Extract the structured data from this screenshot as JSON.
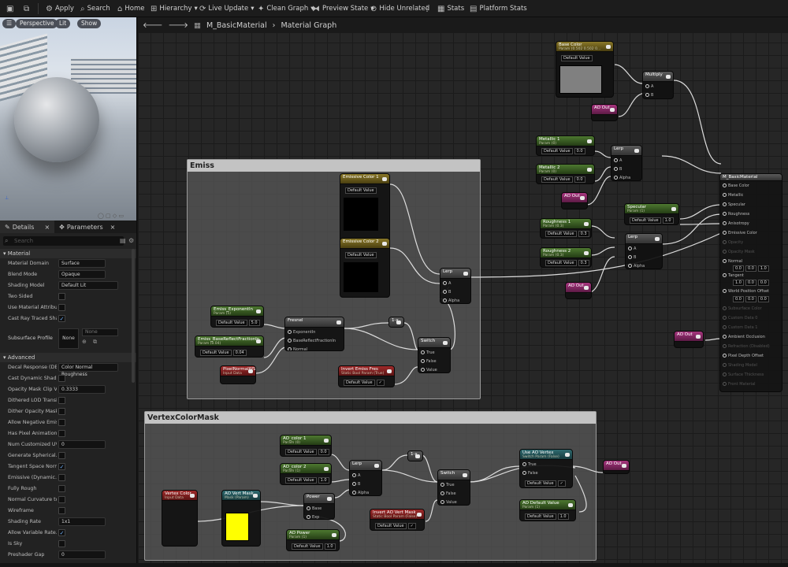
{
  "toolbar": {
    "apply": "Apply",
    "search": "Search",
    "home": "Home",
    "hierarchy": "Hierarchy",
    "live_update": "Live Update",
    "clean_graph": "Clean Graph",
    "preview_state": "Preview State",
    "hide_unrelated": "Hide Unrelated",
    "stats": "Stats",
    "platform_stats": "Platform Stats"
  },
  "viewport": {
    "perspective": "Perspective",
    "lit": "Lit",
    "show": "Show"
  },
  "details": {
    "tab_details": "Details",
    "tab_parameters": "Parameters",
    "search_placeholder": "Search",
    "cat_material": "Material",
    "cat_advanced": "Advanced",
    "rows_material": [
      {
        "label": "Material Domain",
        "value": "Surface"
      },
      {
        "label": "Blend Mode",
        "value": "Opaque"
      },
      {
        "label": "Shading Model",
        "value": "Default Lit"
      },
      {
        "label": "Two Sided",
        "value": ""
      },
      {
        "label": "Use Material Attribut...",
        "value": ""
      },
      {
        "label": "Cast Ray Traced Sha...",
        "value": "✓"
      }
    ],
    "subsurface_label": "Subsurface Profile",
    "subsurface_value": "None",
    "subsurface_combo": "None",
    "rows_advanced": [
      {
        "label": "Decal Response (DB...",
        "value": "Color Normal Roughness"
      },
      {
        "label": "Cast Dynamic Shado...",
        "value": ""
      },
      {
        "label": "Opacity Mask Clip V...",
        "value": "0.3333"
      },
      {
        "label": "Dithered LOD Transi...",
        "value": ""
      },
      {
        "label": "Dither Opacity Mask",
        "value": ""
      },
      {
        "label": "Allow Negative Emis...",
        "value": ""
      },
      {
        "label": "Has Pixel Animation",
        "value": ""
      },
      {
        "label": "Num Customized UVs",
        "value": "0"
      },
      {
        "label": "Generate Spherical...",
        "value": ""
      },
      {
        "label": "Tangent Space Normal",
        "value": "✓"
      },
      {
        "label": "Emissive (Dynamic...",
        "value": ""
      },
      {
        "label": "Fully Rough",
        "value": ""
      },
      {
        "label": "Normal Curvature to...",
        "value": ""
      },
      {
        "label": "Wireframe",
        "value": ""
      },
      {
        "label": "Shading Rate",
        "value": "1x1"
      },
      {
        "label": "Allow Variable Rate...",
        "value": "✓"
      },
      {
        "label": "Is Sky",
        "value": ""
      },
      {
        "label": "Preshader Gap",
        "value": "0"
      }
    ]
  },
  "breadcrumb": {
    "material": "M_BasicMaterial",
    "graph": "Material Graph"
  },
  "comments": {
    "emiss": "Emiss",
    "vcm": "VertexColorMask"
  },
  "nodes": {
    "base_color": {
      "title": "Base Color",
      "sub": "Param (0.502 0.502 0...",
      "dv_label": "Default Value"
    },
    "multiply": {
      "title": "Multiply",
      "a": "A",
      "b": "B"
    },
    "ao_out_1": {
      "title": "AO Out"
    },
    "metallic1": {
      "title": "Metallic 1",
      "sub": "Param (0)",
      "dv_label": "Default Value",
      "dv": "0.0"
    },
    "metallic2": {
      "title": "Metallic 2",
      "sub": "Param (0)",
      "dv_label": "Default Value",
      "dv": "0.0"
    },
    "lerp_m": {
      "title": "Lerp",
      "a": "A",
      "b": "B",
      "alpha": "Alpha"
    },
    "ao_out_2": {
      "title": "AO Out"
    },
    "specular": {
      "title": "Specular",
      "sub": "Param (1)",
      "dv_label": "Default Value",
      "dv": "1.0"
    },
    "rough1": {
      "title": "Roughness 1",
      "sub": "Param (0.3)",
      "dv_label": "Default Value",
      "dv": "0.3"
    },
    "rough2": {
      "title": "Roughness 2",
      "sub": "Param (0.3)",
      "dv_label": "Default Value",
      "dv": "0.3"
    },
    "lerp_r": {
      "title": "Lerp",
      "a": "A",
      "b": "B",
      "alpha": "Alpha"
    },
    "ao_out_3": {
      "title": "AO Out"
    },
    "ao_out_4": {
      "title": "AO Out"
    },
    "result": {
      "title": "M_BasicMaterial",
      "pins": [
        "Base Color",
        "Metallic",
        "Specular",
        "Roughness",
        "Anisotropy",
        "Emissive Color",
        "Opacity",
        "Opacity Mask",
        "Normal",
        "Tangent",
        "World Position Offset",
        "Subsurface Color",
        "Custom Data 0",
        "Custom Data 1",
        "Ambient Occlusion",
        "Refraction (Disabled)",
        "Pixel Depth Offset",
        "Shading Model",
        "Surface Thickness",
        "Front Material"
      ],
      "normal_vals": [
        "0.0",
        "0.0",
        "1.0"
      ],
      "tangent_vals": [
        "1.0",
        "0.0",
        "0.0"
      ],
      "wpo_vals": [
        "0.0",
        "0.0",
        "0.0"
      ]
    },
    "em1": {
      "title": "Emissive Color 1",
      "sub": "Param (0,0,0,0)",
      "dv_label": "Default Value"
    },
    "em2": {
      "title": "Emissive Color 2",
      "sub": "Param (0,0,0,0)",
      "dv_label": "Default Value"
    },
    "lerp_e": {
      "title": "Lerp",
      "a": "A",
      "b": "B",
      "alpha": "Alpha"
    },
    "exp": {
      "title": "Emiss_Exponentln",
      "sub": "Param (5)",
      "dv_label": "Default Value",
      "dv": "5.0"
    },
    "bref": {
      "title": "Emiss_BaseReflectFractionIn",
      "sub": "Param (0.04)",
      "dv_label": "Default Value",
      "dv": "0.04"
    },
    "fresnel": {
      "title": "Fresnel",
      "p1": "ExponentIn",
      "p2": "BaseReflectFractionIn",
      "p3": "Normal"
    },
    "pixn": {
      "title": "PixelNormalWS",
      "sub": "Input Data"
    },
    "one_minus": {
      "title": "1-x"
    },
    "sw_e": {
      "title": "Switch",
      "t": "True",
      "f": "False",
      "v": "Value"
    },
    "inv_e": {
      "title": "Invert Emiss Fres",
      "sub": "Static Bool Param (True)",
      "dv_label": "Default Value"
    },
    "ao1": {
      "title": "AO_color 1",
      "sub": "Param (0)",
      "dv_label": "Default Value",
      "dv": "0.0"
    },
    "ao2": {
      "title": "AO_color 2",
      "sub": "Param (1)",
      "dv_label": "Default Value",
      "dv": "1.0"
    },
    "lerp_v": {
      "title": "Lerp",
      "a": "A",
      "b": "B",
      "alpha": "Alpha"
    },
    "vc": {
      "title": "Vertex Color",
      "sub": "Input Data"
    },
    "avm": {
      "title": "AO Vert Mask",
      "sub": "Mask (Param)"
    },
    "power": {
      "title": "Power",
      "base": "Base",
      "exp": "Exp"
    },
    "aopow": {
      "title": "AO Power",
      "sub": "Param (1)",
      "dv_label": "Default Value",
      "dv": "1.0"
    },
    "one_minus2": {
      "title": "1-x"
    },
    "sw_v": {
      "title": "Switch",
      "t": "True",
      "f": "False",
      "v": "Value"
    },
    "inv_v": {
      "title": "Invert AO Vert Mask",
      "sub": "Static Bool Param (False)",
      "dv_label": "Default Value"
    },
    "use_ao": {
      "title": "Use AO Vertex",
      "sub": "Switch Param (False)",
      "t": "True",
      "f": "False",
      "dv_label": "Default Value"
    },
    "ao_out_v": {
      "title": "AO Out"
    },
    "ao_def": {
      "title": "AO Default Value",
      "sub": "Param (1)",
      "dv_label": "Default Value",
      "dv": "1.0"
    }
  },
  "colors": {
    "base_swatch": "#808080",
    "em_swatch": "#000000",
    "mask_swatch": "#ffff00"
  }
}
